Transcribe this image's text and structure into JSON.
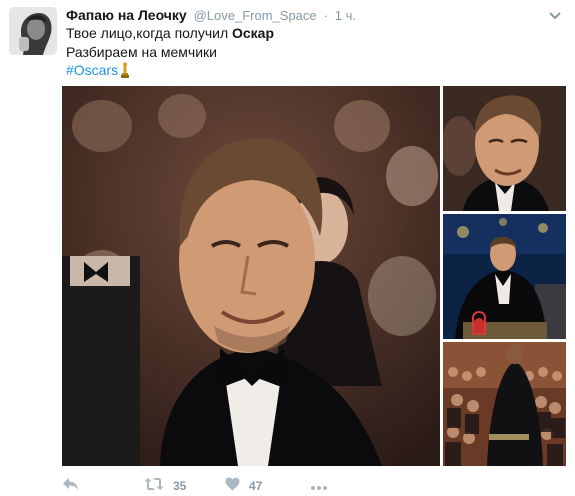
{
  "tweet": {
    "author_name": "Фапаю на Леочку",
    "author_handle": "@Love_From_Space",
    "separator": "·",
    "time": "1 ч.",
    "line1_prefix": "Твое лицо,когда получил ",
    "line1_bold": "Оскар",
    "line2": "Разбираем на мемчики",
    "hashtag": "#Oscars"
  },
  "actions": {
    "retweet_count": "35",
    "like_count": "47"
  },
  "colors": {
    "link": "#1b95e0",
    "muted": "#8899a6",
    "text": "#14171a"
  },
  "icons": [
    "avatar",
    "caret-down-icon",
    "oscar-trophy-icon",
    "reply-icon",
    "retweet-icon",
    "heart-icon",
    "more-icon"
  ]
}
